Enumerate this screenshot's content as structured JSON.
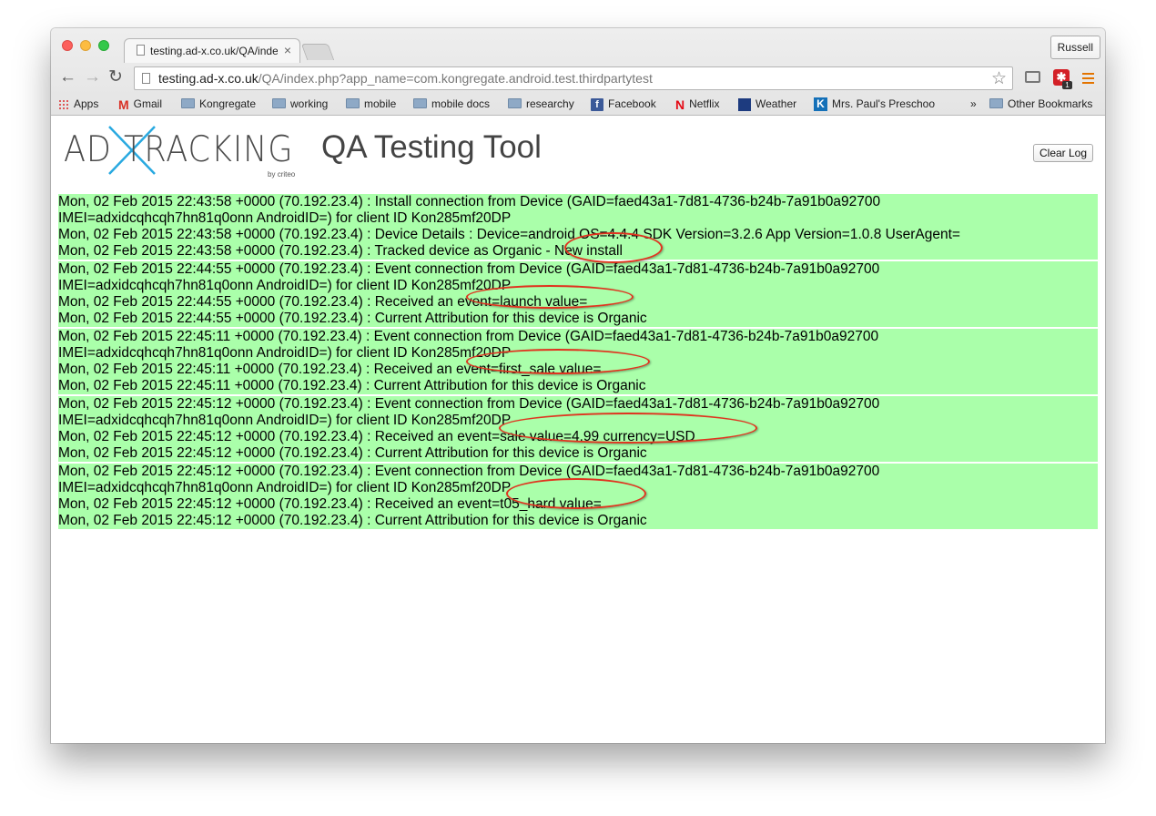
{
  "browser": {
    "tab_title": "testing.ad-x.co.uk/QA/index",
    "tab_close": "×",
    "profile_name": "Russell",
    "nav": {
      "back": "←",
      "forward": "→",
      "reload": "↻"
    },
    "url_host": "testing.ad-x.co.uk",
    "url_path": "/QA/index.php?app_name=com.kongregate.android.test.thirdpartytest",
    "star": "☆",
    "extension_icon": "✱",
    "extension_badge": "1",
    "bookmarks": [
      {
        "label": "Apps",
        "icon": "apps-icon"
      },
      {
        "label": "Gmail",
        "icon": "gmail-icon"
      },
      {
        "label": "Kongregate",
        "icon": "folder-icon"
      },
      {
        "label": "working",
        "icon": "folder-icon"
      },
      {
        "label": "mobile",
        "icon": "folder-icon"
      },
      {
        "label": "mobile docs",
        "icon": "folder-icon"
      },
      {
        "label": "researchy",
        "icon": "folder-icon"
      },
      {
        "label": "Facebook",
        "icon": "facebook-icon"
      },
      {
        "label": "Netflix",
        "icon": "netflix-icon"
      },
      {
        "label": "Weather",
        "icon": "weather-icon"
      },
      {
        "label": "Mrs. Paul's Preschoo",
        "icon": "kaizena-icon"
      }
    ],
    "bookmarks_overflow": "»",
    "other_bookmarks": "Other Bookmarks"
  },
  "page": {
    "logo_ad": "AD",
    "logo_tracking": "TRACKING",
    "logo_by": "by",
    "logo_brand": "criteo",
    "title": "QA Testing Tool",
    "clear_button": "Clear Log",
    "log_bg_color": "#aaffaa",
    "annotation_color": "#e0341f",
    "entries": [
      {
        "lines": [
          "Mon, 02 Feb 2015 22:43:58 +0000 (70.192.23.4) : Install connection from Device (GAID=faed43a1-7d81-4736-b24b-7a91b0a92700",
          "IMEI=adxidcqhcqh7hn81q0onn AndroidID=) for client ID Kon285mf20DP",
          "Mon, 02 Feb 2015 22:43:58 +0000 (70.192.23.4) : Device Details : Device=android OS=4.4.4 SDK Version=3.2.6 App Version=1.0.8 UserAgent=",
          "Mon, 02 Feb 2015 22:43:58 +0000 (70.192.23.4) : Tracked device as Organic - New install"
        ]
      },
      {
        "lines": [
          "Mon, 02 Feb 2015 22:44:55 +0000 (70.192.23.4) : Event connection from Device (GAID=faed43a1-7d81-4736-b24b-7a91b0a92700",
          "IMEI=adxidcqhcqh7hn81q0onn AndroidID=) for client ID Kon285mf20DP",
          "Mon, 02 Feb 2015 22:44:55 +0000 (70.192.23.4) : Received an event=launch value=",
          "Mon, 02 Feb 2015 22:44:55 +0000 (70.192.23.4) : Current Attribution for this device is Organic"
        ]
      },
      {
        "lines": [
          "Mon, 02 Feb 2015 22:45:11 +0000 (70.192.23.4) : Event connection from Device (GAID=faed43a1-7d81-4736-b24b-7a91b0a92700",
          "IMEI=adxidcqhcqh7hn81q0onn AndroidID=) for client ID Kon285mf20DP",
          "Mon, 02 Feb 2015 22:45:11 +0000 (70.192.23.4) : Received an event=first_sale value=",
          "Mon, 02 Feb 2015 22:45:11 +0000 (70.192.23.4) : Current Attribution for this device is Organic"
        ]
      },
      {
        "lines": [
          "Mon, 02 Feb 2015 22:45:12 +0000 (70.192.23.4) : Event connection from Device (GAID=faed43a1-7d81-4736-b24b-7a91b0a92700",
          "IMEI=adxidcqhcqh7hn81q0onn AndroidID=) for client ID Kon285mf20DP",
          "Mon, 02 Feb 2015 22:45:12 +0000 (70.192.23.4) : Received an event=sale value=4.99 currency=USD",
          "Mon, 02 Feb 2015 22:45:12 +0000 (70.192.23.4) : Current Attribution for this device is Organic"
        ]
      },
      {
        "lines": [
          "Mon, 02 Feb 2015 22:45:12 +0000 (70.192.23.4) : Event connection from Device (GAID=faed43a1-7d81-4736-b24b-7a91b0a92700",
          "IMEI=adxidcqhcqh7hn81q0onn AndroidID=) for client ID Kon285mf20DP",
          "Mon, 02 Feb 2015 22:45:12 +0000 (70.192.23.4) : Received an event=t05_hard value=",
          "Mon, 02 Feb 2015 22:45:12 +0000 (70.192.23.4) : Current Attribution for this device is Organic"
        ]
      }
    ]
  }
}
